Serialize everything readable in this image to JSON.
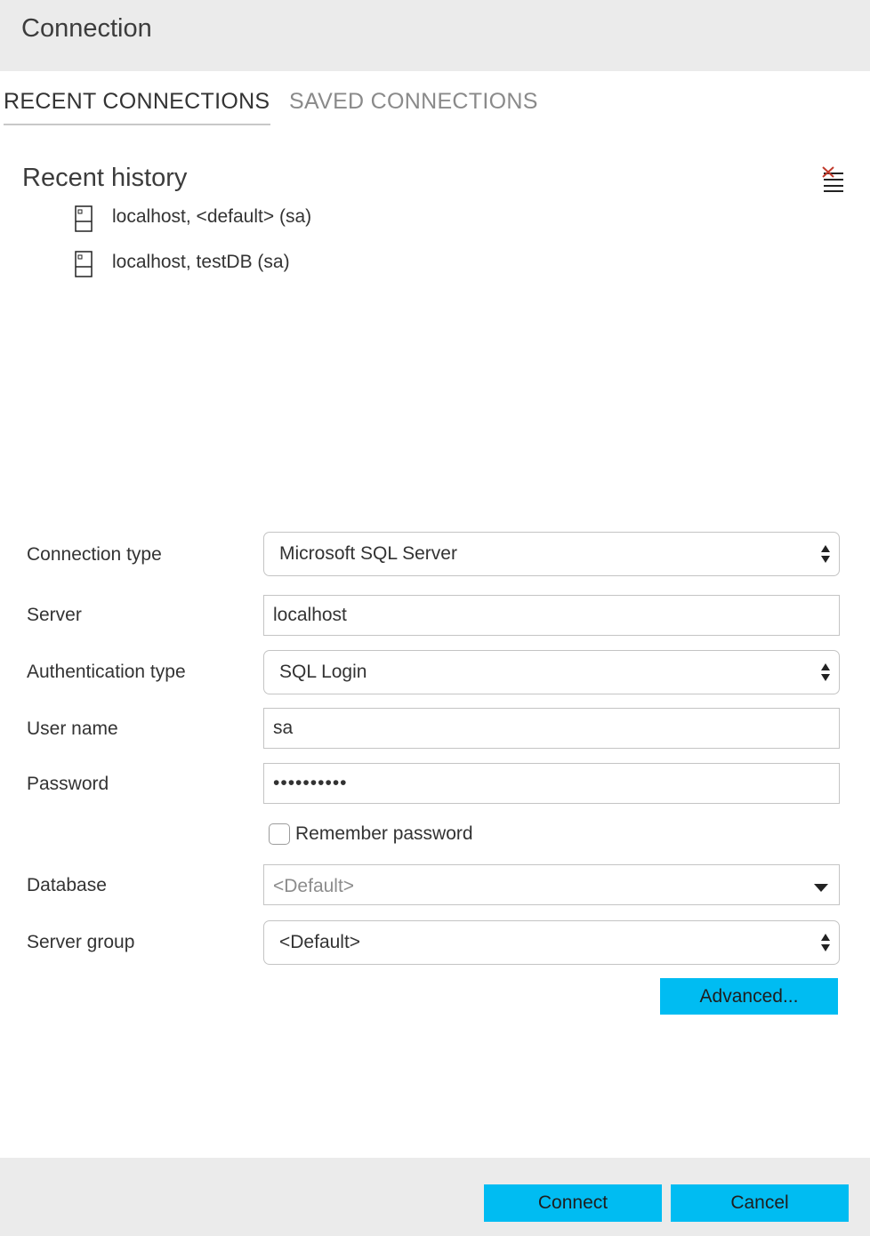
{
  "dialog": {
    "title": "Connection"
  },
  "tabs": [
    {
      "label": "RECENT CONNECTIONS",
      "active": true
    },
    {
      "label": "SAVED CONNECTIONS",
      "active": false
    }
  ],
  "recent": {
    "title": "Recent history",
    "clear_icon": "clear-list-icon",
    "items": [
      {
        "label": "localhost, <default> (sa)",
        "icon": "server-icon"
      },
      {
        "label": "localhost, testDB (sa)",
        "icon": "server-icon"
      }
    ]
  },
  "form": {
    "connection_type": {
      "label": "Connection type",
      "value": "Microsoft SQL Server"
    },
    "server": {
      "label": "Server",
      "value": "localhost"
    },
    "authentication_type": {
      "label": "Authentication type",
      "value": "SQL Login"
    },
    "user_name": {
      "label": "User name",
      "value": "sa"
    },
    "password": {
      "label": "Password",
      "value": "••••••••••"
    },
    "remember_password": {
      "label": "Remember password",
      "checked": false
    },
    "database": {
      "label": "Database",
      "value": "<Default>"
    },
    "server_group": {
      "label": "Server group",
      "value": "<Default>"
    },
    "advanced_label": "Advanced..."
  },
  "footer": {
    "connect_label": "Connect",
    "cancel_label": "Cancel"
  },
  "colors": {
    "accent": "#00bcf2",
    "titlebar": "#ebebeb",
    "clear_x": "#c0392b"
  }
}
